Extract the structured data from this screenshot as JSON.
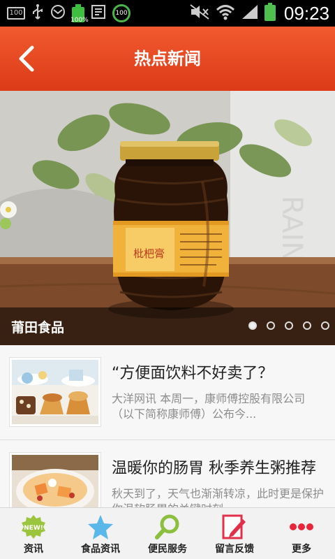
{
  "status_bar": {
    "time": "09:23",
    "left_icons": [
      "box-100-icon",
      "usb-icon",
      "mail-icon",
      "battery-100-icon",
      "text-icon",
      "circle-100-icon"
    ],
    "right_icons": [
      "mute-icon",
      "wifi-icon",
      "signal-icon",
      "battery-icon"
    ],
    "box_label": "100",
    "battery_pct": "100%",
    "circle_label": "100"
  },
  "header": {
    "title": "热点新闻",
    "accent": "#e8461f"
  },
  "hero": {
    "caption": "莆田食品",
    "slide_count": 5,
    "active_slide": 1,
    "label_text": "枇杷膏"
  },
  "news": [
    {
      "title": "“方便面饮料不好卖了？",
      "summary": "大洋网讯 本周一，康师傅控股有限公司（以下简称康师傅）公布今..."
    },
    {
      "title": "温暖你的肠胃 秋季养生粥推荐",
      "summary": "秋天到了，天气也渐渐转凉，此时更是保护你温软肠胃的关键时刻..."
    }
  ],
  "bottom_nav": [
    {
      "label": "资讯",
      "icon": "new-badge-icon"
    },
    {
      "label": "食品资讯",
      "icon": "star-icon"
    },
    {
      "label": "便民服务",
      "icon": "magnifier-icon"
    },
    {
      "label": "留言反馈",
      "icon": "edit-note-icon"
    },
    {
      "label": "更多",
      "icon": "more-dots-icon"
    }
  ]
}
